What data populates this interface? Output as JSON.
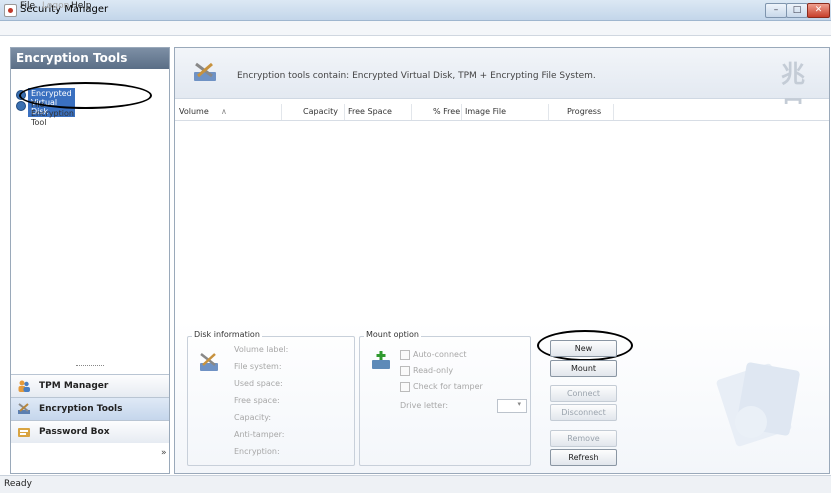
{
  "window": {
    "title": "Security Manager"
  },
  "menu": {
    "file": "File",
    "logon": "Logon",
    "help": "Help"
  },
  "sidebar": {
    "header": "Encryption Tools",
    "tree": [
      {
        "label": "Encrypted Virtual Disk",
        "selected": true
      },
      {
        "label": "File Encryption Tool",
        "selected": false
      }
    ],
    "nav": [
      {
        "label": "TPM Manager",
        "icon": "people-icon"
      },
      {
        "label": "Encryption Tools",
        "icon": "tools-icon"
      },
      {
        "label": "Password Box",
        "icon": "password-icon"
      }
    ],
    "more": "»"
  },
  "banner": {
    "text": "Encryption tools contain: Encrypted Virtual Disk, TPM + Encrypting File System.",
    "logo": "兆日"
  },
  "table": {
    "columns": [
      "Volume",
      "Capacity",
      "Free Space",
      "% Free",
      "Image File",
      "Progress"
    ],
    "sort_indicator": "∧"
  },
  "disk_info": {
    "title": "Disk information",
    "labels": [
      "Volume label:",
      "File system:",
      "Used space:",
      "Free space:",
      "Capacity:",
      "Anti-tamper:",
      "Encryption:"
    ]
  },
  "mount_option": {
    "title": "Mount option",
    "auto_connect": "Auto-connect",
    "read_only": "Read-only",
    "check_tamper": "Check for tamper",
    "drive_letter": "Drive letter:"
  },
  "buttons": {
    "new": "New",
    "mount": "Mount",
    "connect": "Connect",
    "disconnect": "Disconnect",
    "remove": "Remove",
    "refresh": "Refresh"
  },
  "status": {
    "text": "Ready"
  },
  "colors": {
    "accent": "#3a70c0",
    "header": "#6b7f96"
  }
}
